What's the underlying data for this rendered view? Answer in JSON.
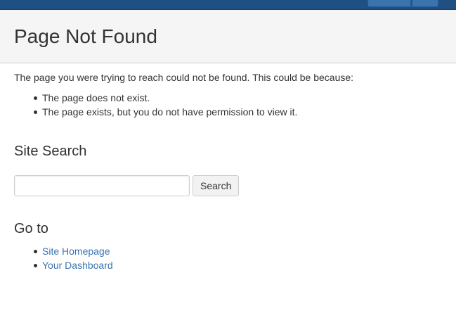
{
  "page": {
    "title": "Page Not Found"
  },
  "message": {
    "intro": "The page you were trying to reach could not be found. This could be because:",
    "reasons": [
      "The page does not exist.",
      "The page exists, but you do not have permission to view it."
    ]
  },
  "search": {
    "heading": "Site Search",
    "input_value": "",
    "placeholder": "",
    "button_label": "Search"
  },
  "goto": {
    "heading": "Go to",
    "links": [
      "Site Homepage",
      "Your Dashboard"
    ]
  },
  "colors": {
    "topbar": "#205081",
    "link": "#3b73af",
    "header_bg": "#f5f5f5"
  }
}
